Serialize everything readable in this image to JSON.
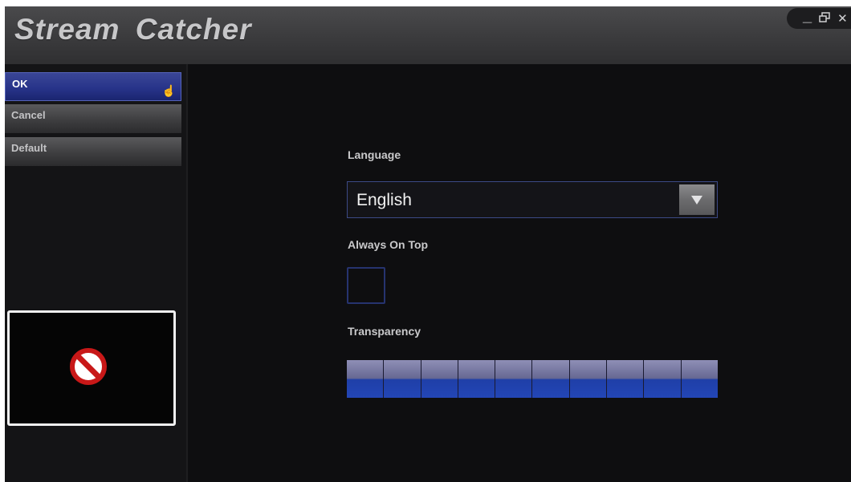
{
  "app": {
    "title": "Stream Catcher"
  },
  "window_controls": {
    "minimize_icon": "minimize-icon",
    "restore_icon": "restore-icon",
    "close_icon": "close-icon"
  },
  "sidebar": {
    "ok_label": "OK",
    "cancel_label": "Cancel",
    "default_label": "Default"
  },
  "preview": {
    "icon": "no-entry-icon"
  },
  "settings": {
    "language_label": "Language",
    "language_value": "English",
    "always_on_top_label": "Always On Top",
    "always_on_top_checked": false,
    "transparency_label": "Transparency",
    "transparency_segments": 10
  },
  "colors": {
    "accent": "#2346b6",
    "background": "#0e0e10"
  }
}
